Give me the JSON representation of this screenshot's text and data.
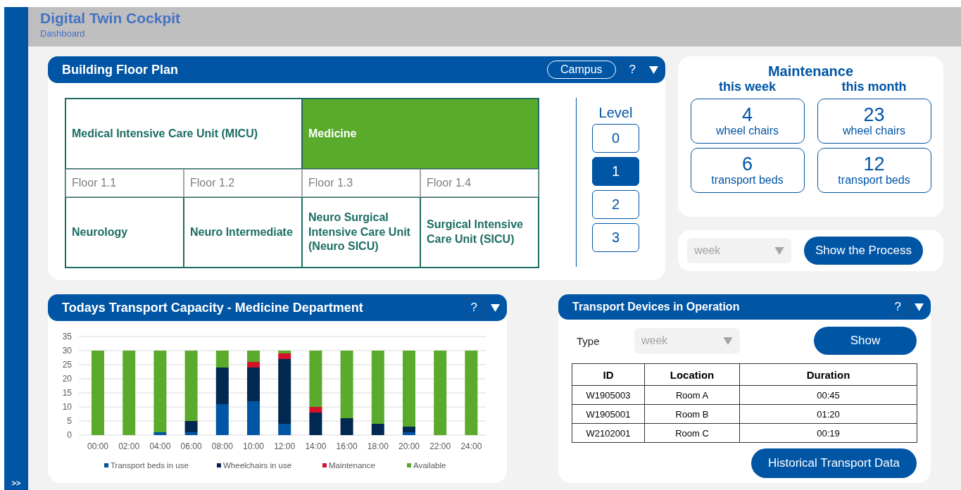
{
  "app": {
    "title": "Digital Twin Cockpit",
    "subtitle": "Dashboard",
    "sidebar_toggle": ">>"
  },
  "floor_plan": {
    "title": "Building Floor Plan",
    "scope_button": "Campus",
    "help": "?",
    "units": [
      {
        "name": "Medical Intensive Care Unit (MICU)",
        "selected": false
      },
      {
        "name": "Medicine",
        "selected": true
      }
    ],
    "floors": [
      "Floor 1.1",
      "Floor 1.2",
      "Floor 1.3",
      "Floor 1.4"
    ],
    "departments": [
      {
        "name": "Neurology",
        "selected": false
      },
      {
        "name": "Neuro Intermediate",
        "selected": false
      },
      {
        "name": "Neuro Surgical Intensive Care Unit (Neuro SICU)",
        "selected": false
      },
      {
        "name": "Surgical Intensive Care Unit (SICU)",
        "selected": false
      }
    ],
    "level_label": "Level",
    "levels": [
      {
        "label": "0",
        "selected": false
      },
      {
        "label": "1",
        "selected": true
      },
      {
        "label": "2",
        "selected": false
      },
      {
        "label": "3",
        "selected": false
      }
    ]
  },
  "maintenance": {
    "title": "Maintenance",
    "columns": [
      {
        "heading": "this week",
        "tiles": [
          {
            "value": "4",
            "label": "wheel chairs"
          },
          {
            "value": "6",
            "label": "transport beds"
          }
        ]
      },
      {
        "heading": "this month",
        "tiles": [
          {
            "value": "23",
            "label": "wheel chairs"
          },
          {
            "value": "12",
            "label": "transport beds"
          }
        ]
      }
    ]
  },
  "process": {
    "period": "week",
    "button": "Show the Process"
  },
  "capacity": {
    "title": "Todays Transport Capacity - Medicine Department",
    "help": "?",
    "chart_data": {
      "type": "bar",
      "stacked": true,
      "categories": [
        "00:00",
        "02:00",
        "04:00",
        "06:00",
        "08:00",
        "10:00",
        "12:00",
        "14:00",
        "16:00",
        "18:00",
        "20:00",
        "22:00",
        "24:00"
      ],
      "series": [
        {
          "name": "Transport beds in use",
          "color": "#0055a5",
          "values": [
            0,
            0,
            1,
            1,
            11,
            12,
            4,
            0,
            0,
            0,
            1,
            0,
            0
          ]
        },
        {
          "name": "Wheelchairs in use",
          "color": "#002850",
          "values": [
            0,
            0,
            0,
            4,
            13,
            12,
            23,
            8,
            6,
            4,
            2,
            0,
            0
          ]
        },
        {
          "name": "Maintenance",
          "color": "#d5112a",
          "values": [
            0,
            0,
            0,
            0,
            0,
            2,
            2,
            2,
            0,
            0,
            0,
            0,
            0
          ]
        },
        {
          "name": "Available",
          "color": "#5aab2b",
          "values": [
            30,
            30,
            29,
            25,
            6,
            4,
            1,
            20,
            24,
            26,
            27,
            30,
            30
          ]
        }
      ],
      "ylim": [
        0,
        35
      ],
      "yticks": [
        0,
        5,
        10,
        15,
        20,
        25,
        30,
        35
      ],
      "grid": true,
      "legend": true
    }
  },
  "devices": {
    "title": "Transport Devices in Operation",
    "help": "?",
    "type_label": "Type",
    "type_value": "week",
    "show_button": "Show",
    "columns": [
      "ID",
      "Location",
      "Duration"
    ],
    "rows": [
      [
        "W1905003",
        "Room A",
        "00:45"
      ],
      [
        "W1905001",
        "Room B",
        "01:20"
      ],
      [
        "W2102001",
        "Room C",
        "00:19"
      ]
    ],
    "history_button": "Historical Transport Data"
  }
}
